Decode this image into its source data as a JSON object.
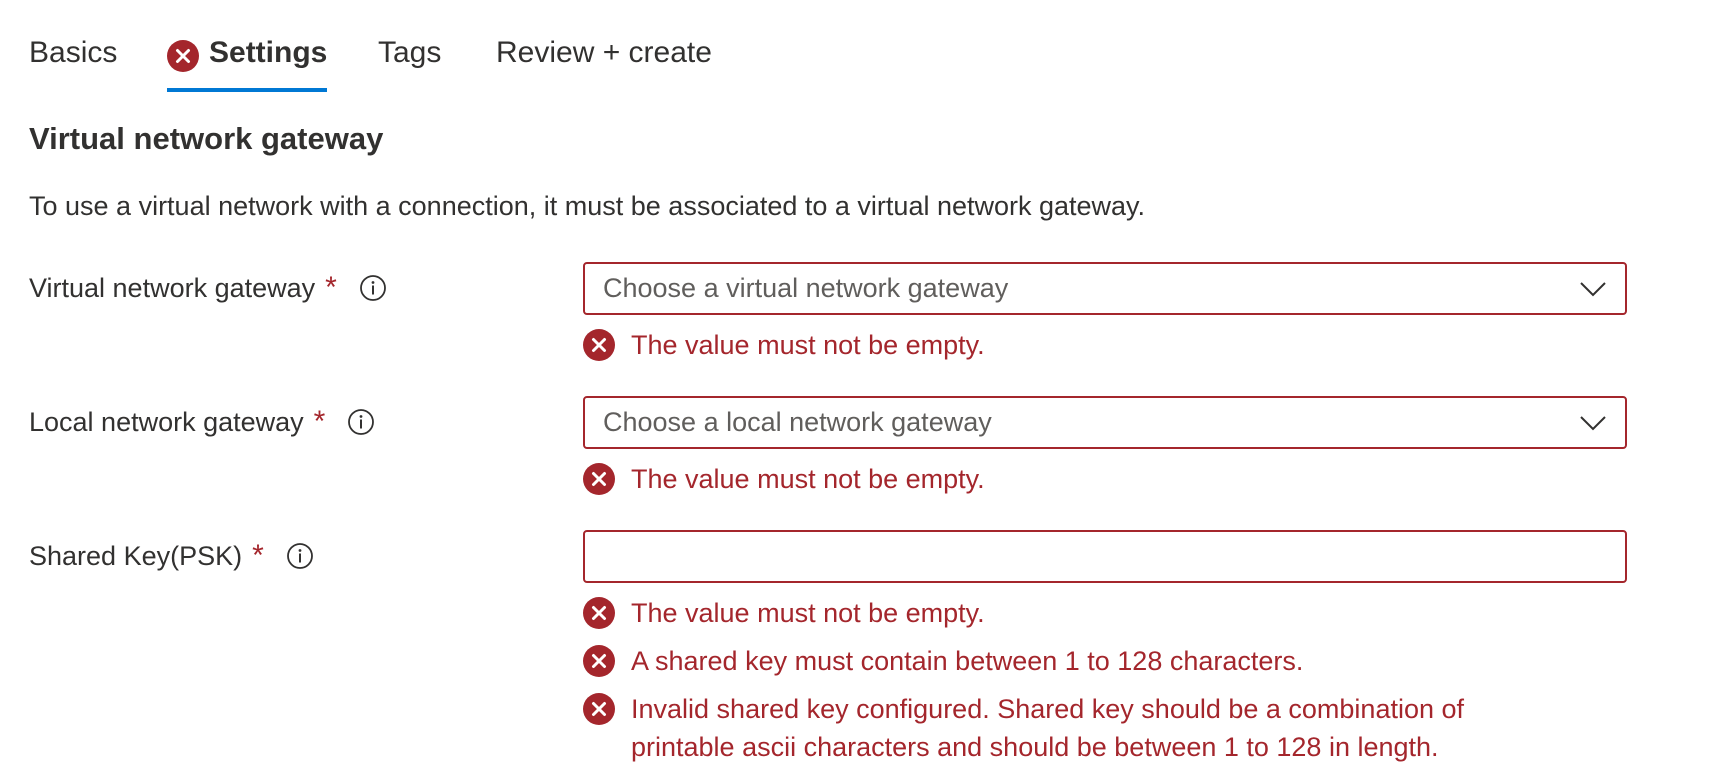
{
  "tabs": [
    {
      "label": "Basics",
      "active": false,
      "error": false
    },
    {
      "label": "Settings",
      "active": true,
      "error": true
    },
    {
      "label": "Tags",
      "active": false,
      "error": false
    },
    {
      "label": "Review + create",
      "active": false,
      "error": false
    }
  ],
  "section": {
    "title": "Virtual network gateway",
    "description": "To use a virtual network with a connection, it must be associated to a virtual network gateway."
  },
  "fields": {
    "vng": {
      "label": "Virtual network gateway",
      "required_mark": "*",
      "placeholder": "Choose a virtual network gateway",
      "errors": [
        "The value must not be empty."
      ]
    },
    "lng": {
      "label": "Local network gateway",
      "required_mark": "*",
      "placeholder": "Choose a local network gateway",
      "errors": [
        "The value must not be empty."
      ]
    },
    "psk": {
      "label": "Shared Key(PSK)",
      "required_mark": "*",
      "value": "",
      "errors": [
        "The value must not be empty.",
        "A shared key must contain between 1 to 128 characters.",
        "Invalid shared key configured. Shared key should be a combination of printable ascii characters and should be between 1 to 128 in length."
      ]
    }
  },
  "colors": {
    "error": "#a4262c",
    "accent": "#0078d4",
    "text": "#323130",
    "placeholder": "#605e5c"
  },
  "icons": {
    "error": "error-circle-icon",
    "info": "info-circle-icon",
    "dropdown": "chevron-down-icon"
  }
}
